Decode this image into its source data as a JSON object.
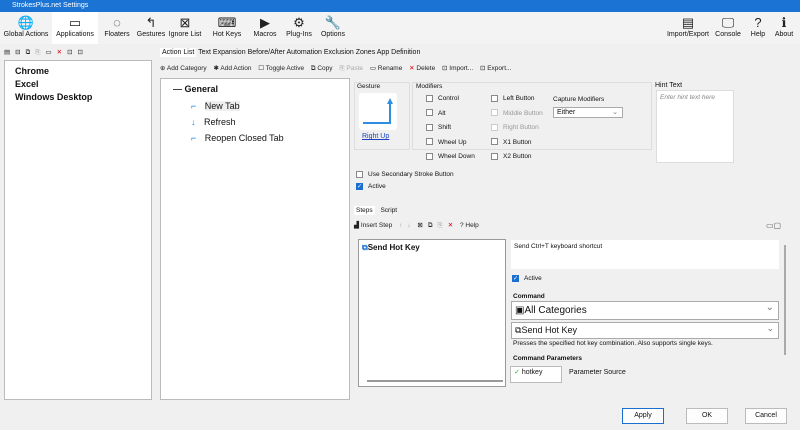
{
  "window": {
    "title": "StrokesPlus.net Settings"
  },
  "ribbon": {
    "left": [
      {
        "label": "Global Actions",
        "icon": "globe-icon",
        "glyph": "🌐"
      },
      {
        "label": "Applications",
        "icon": "window-icon",
        "glyph": "▭"
      },
      {
        "label": "Floaters",
        "icon": "floaters-icon",
        "glyph": "◌"
      },
      {
        "label": "Gestures",
        "icon": "gesture-icon",
        "glyph": "↰"
      },
      {
        "label": "Ignore List",
        "icon": "ignore-icon",
        "glyph": "⊠"
      },
      {
        "label": "Hot Keys",
        "icon": "hotkey-icon",
        "glyph": "⌨"
      },
      {
        "label": "Macros",
        "icon": "macro-icon",
        "glyph": "▶"
      },
      {
        "label": "Plug-Ins",
        "icon": "plugin-icon",
        "glyph": "⚙"
      },
      {
        "label": "Options",
        "icon": "wrench-icon",
        "glyph": "🔧"
      }
    ],
    "right": [
      {
        "label": "Import/Export",
        "icon": "import-export-icon",
        "glyph": "▤"
      },
      {
        "label": "Console",
        "icon": "console-icon",
        "glyph": "🖵"
      },
      {
        "label": "Help",
        "icon": "help-icon",
        "glyph": "?"
      },
      {
        "label": "About",
        "icon": "about-icon",
        "glyph": "ℹ"
      }
    ]
  },
  "apps": [
    "Chrome",
    "Excel",
    "Windows Desktop"
  ],
  "tabs": [
    "Action List",
    "Text Expansion",
    "Before/After Automation",
    "Exclusion Zones",
    "App Definition"
  ],
  "toolbar": [
    "Add Category",
    "Add Action",
    "Toggle Active",
    "Copy",
    "Paste",
    "Rename",
    "Delete",
    "Import...",
    "Export..."
  ],
  "tree": {
    "category": "General",
    "actions": [
      "New Tab",
      "Refresh",
      "Reopen Closed Tab"
    ]
  },
  "gesture": {
    "label": "Gesture",
    "name": "Right Up"
  },
  "modifiers": {
    "label": "Modifiers",
    "col1": [
      "Control",
      "Alt",
      "Shift",
      "Wheel Up",
      "Wheel Down"
    ],
    "col2": [
      "Left Button",
      "Middle Button",
      "Right Button",
      "X1 Button",
      "X2 Button"
    ],
    "capture_label": "Capture Modifiers",
    "capture_value": "Either"
  },
  "hint": {
    "label": "Hint Text",
    "placeholder": "Enter hint text here"
  },
  "options": {
    "secondary": "Use Secondary Stroke Button",
    "active": "Active"
  },
  "steps": {
    "tabs": [
      "Steps",
      "Script"
    ],
    "insert": "Insert Step",
    "help": "Help",
    "items": [
      "Send Hot Key"
    ],
    "description": "Send Ctrl+T keyboard shortcut",
    "active": "Active",
    "command_label": "Command",
    "category": "All Categories",
    "command": "Send Hot Key",
    "command_desc": "Presses the specified hot key combination. Also supports single keys.",
    "params_label": "Command Parameters",
    "param": "hotkey",
    "param_source": "Parameter Source"
  },
  "buttons": {
    "apply": "Apply",
    "ok": "OK",
    "cancel": "Cancel"
  }
}
